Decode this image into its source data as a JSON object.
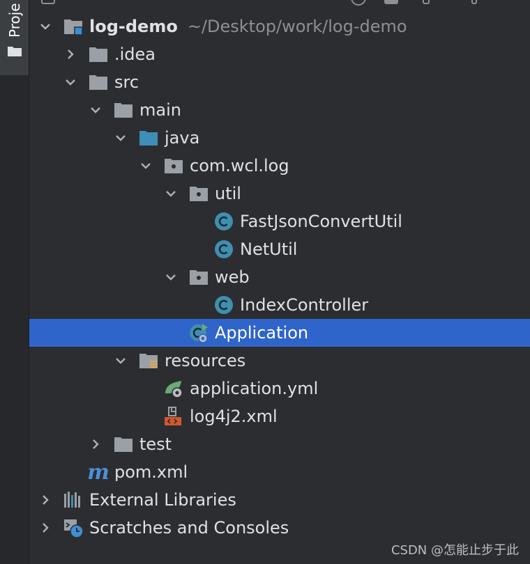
{
  "sidebar": {
    "tab_label": "Proje"
  },
  "tree": {
    "rows": [
      {
        "label": "log-demo",
        "hint": "~/Desktop/work/log-demo"
      },
      {
        "label": ".idea"
      },
      {
        "label": "src"
      },
      {
        "label": "main"
      },
      {
        "label": "java"
      },
      {
        "label": "com.wcl.log"
      },
      {
        "label": "util"
      },
      {
        "label": "FastJsonConvertUtil"
      },
      {
        "label": "NetUtil"
      },
      {
        "label": "web"
      },
      {
        "label": "IndexController"
      },
      {
        "label": "Application"
      },
      {
        "label": "resources"
      },
      {
        "label": "application.yml"
      },
      {
        "label": "log4j2.xml"
      },
      {
        "label": "test"
      },
      {
        "label": "pom.xml"
      },
      {
        "label": "External Libraries"
      },
      {
        "label": "Scratches and Consoles"
      }
    ]
  },
  "watermark": "CSDN @怎能止步于此",
  "colors": {
    "background": "#2b2d30",
    "selection": "#2f65ca",
    "folder": "#9aa0a6",
    "source_folder": "#3d8fb8",
    "class_icon": "#3f8fb0",
    "maven": "#4c8fd6",
    "spring": "#6aab73"
  }
}
